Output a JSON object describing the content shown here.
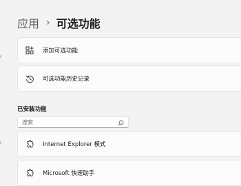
{
  "breadcrumb": {
    "parent": "应用",
    "separator": "›",
    "current": "可选功能"
  },
  "actions": [
    {
      "label": "添加可选功能",
      "icon": "add-grid-icon"
    },
    {
      "label": "可选功能历史记录",
      "icon": "history-icon"
    }
  ],
  "installed": {
    "title": "已安装功能",
    "search_placeholder": "搜索",
    "items": [
      {
        "label": "Internet Explorer 模式",
        "icon": "puzzle-icon"
      },
      {
        "label": "Microsoft 快速助手",
        "icon": "puzzle-icon"
      }
    ]
  }
}
